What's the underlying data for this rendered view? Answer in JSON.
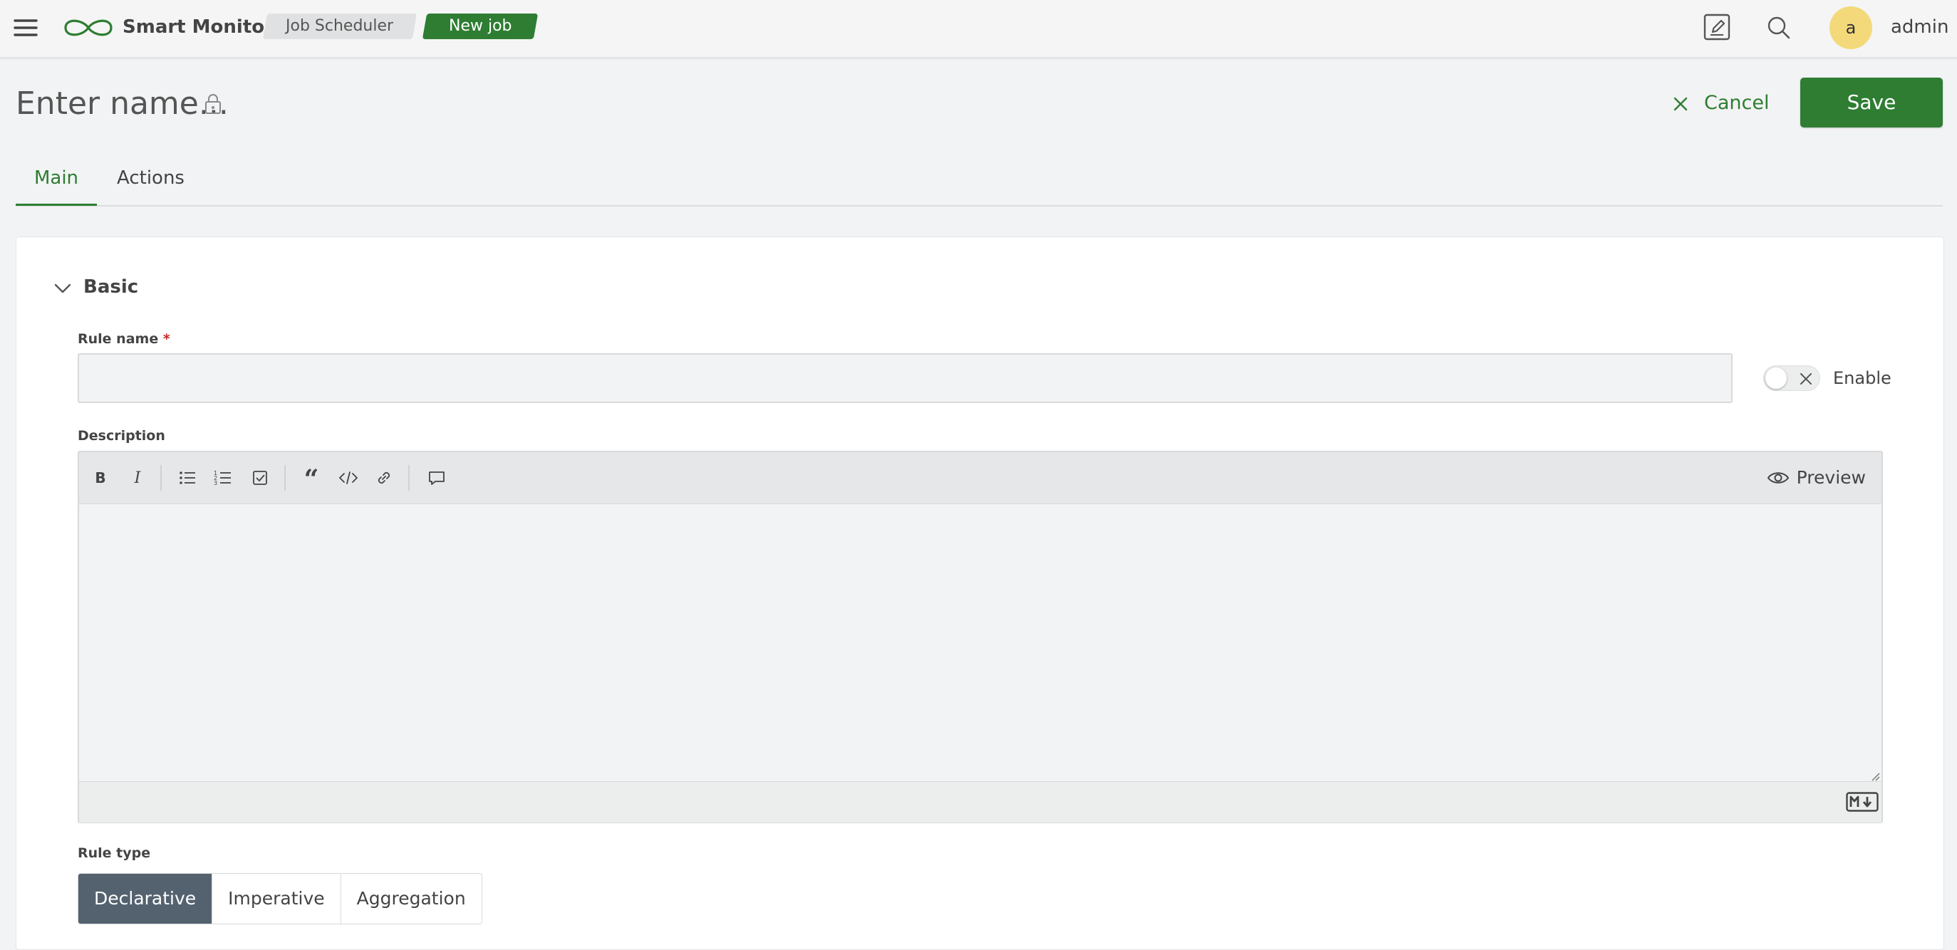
{
  "header": {
    "app_name": "Smart Monitor",
    "breadcrumbs": [
      "Job Scheduler",
      "New job"
    ],
    "avatar_letter": "a",
    "username": "admin",
    "brand_color": "#2e7d32",
    "icons": [
      "menu-icon",
      "logo-infinity-icon",
      "edit-icon",
      "search-icon"
    ]
  },
  "page": {
    "title": "Enter name...",
    "cancel_label": "Cancel",
    "save_label": "Save"
  },
  "tabs": [
    {
      "label": "Main",
      "active": true
    },
    {
      "label": "Actions",
      "active": false
    }
  ],
  "section": {
    "title": "Basic",
    "expanded": true
  },
  "form": {
    "rule_name_label": "Rule name",
    "rule_name_required_mark": "*",
    "rule_name_value": "",
    "enable_label": "Enable",
    "enable_on": false,
    "description_label": "Description",
    "description_value": "",
    "editor_tools": [
      "bold-icon",
      "italic-icon",
      "bulleted-list-icon",
      "numbered-list-icon",
      "checklist-icon",
      "quote-icon",
      "code-icon",
      "link-icon",
      "comment-icon"
    ],
    "preview_label": "Preview",
    "rule_type_label": "Rule type",
    "rule_types": [
      "Declarative",
      "Imperative",
      "Aggregation"
    ],
    "rule_type_selected": "Declarative"
  }
}
